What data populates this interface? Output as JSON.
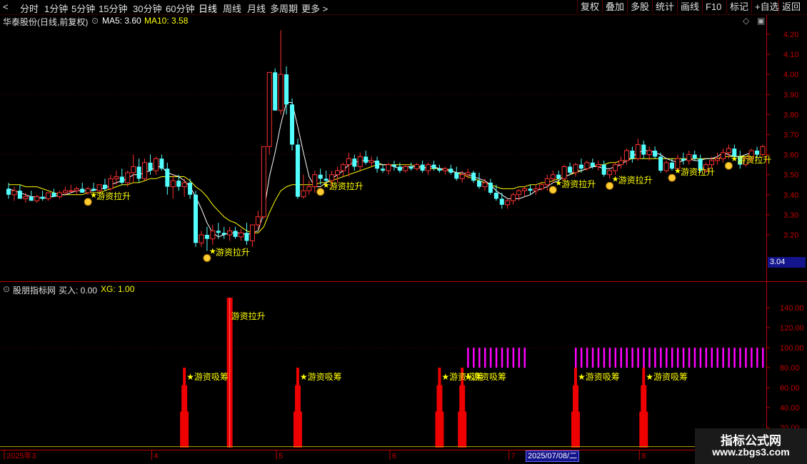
{
  "toolbar": {
    "periods": [
      "分时",
      "1分钟",
      "5分钟",
      "15分钟",
      "30分钟",
      "60分钟",
      "日线",
      "周线",
      "月线",
      "多周期",
      "更多"
    ],
    "active_period": "日线",
    "buttons": [
      "复权",
      "叠加",
      "多股",
      "统计",
      "画线",
      "F10",
      "标记",
      "+自选",
      "返回"
    ]
  },
  "header": {
    "stock": "华泰股份(日线,前复权)",
    "ma5_label": "MA5: 3.60",
    "ma10_label": "MA10: 3.58"
  },
  "indicator_header": {
    "name": "股朋指标网",
    "buy_label": "买入: 0.00",
    "xg_label": "XG: 1.00"
  },
  "price_tag": "3.04",
  "date_tag": "2025/07/08/二",
  "watermark": {
    "line1": "指标公式网",
    "line2": "www.zbgs3.com"
  },
  "colors": {
    "up": "#ff3232",
    "down": "#54ffff",
    "ma5": "#ffffff",
    "ma10": "#ffff00",
    "magenta": "#ff00ff",
    "axis": "#c00000",
    "label": "#ffff00"
  },
  "chart_data": {
    "type": "candlestick",
    "price_axis": {
      "ticks": [
        "3.20",
        "3.30",
        "3.40",
        "3.50",
        "3.60",
        "3.70",
        "3.80",
        "3.90",
        "4.00",
        "4.10",
        "4.20"
      ],
      "ylim": [
        3.04,
        4.25
      ]
    },
    "indicator_axis": {
      "ticks": [
        "20.00",
        "40.00",
        "60.00",
        "80.00",
        "100.00",
        "120.00",
        "140.00"
      ],
      "ylim": [
        0,
        150
      ]
    },
    "x_labels": [
      "2025年3",
      "4",
      "5",
      "6",
      "7",
      "8"
    ],
    "ohlc": [
      [
        3.43,
        3.46,
        3.38,
        3.4
      ],
      [
        3.4,
        3.44,
        3.37,
        3.42
      ],
      [
        3.42,
        3.45,
        3.39,
        3.38
      ],
      [
        3.38,
        3.41,
        3.36,
        3.39
      ],
      [
        3.39,
        3.42,
        3.37,
        3.37
      ],
      [
        3.37,
        3.4,
        3.36,
        3.39
      ],
      [
        3.39,
        3.42,
        3.37,
        3.38
      ],
      [
        3.38,
        3.41,
        3.37,
        3.41
      ],
      [
        3.41,
        3.43,
        3.39,
        3.39
      ],
      [
        3.39,
        3.42,
        3.38,
        3.41
      ],
      [
        3.41,
        3.44,
        3.4,
        3.42
      ],
      [
        3.42,
        3.45,
        3.41,
        3.42
      ],
      [
        3.42,
        3.44,
        3.4,
        3.43
      ],
      [
        3.43,
        3.46,
        3.41,
        3.41
      ],
      [
        3.41,
        3.44,
        3.4,
        3.43
      ],
      [
        3.43,
        3.46,
        3.42,
        3.42
      ],
      [
        3.42,
        3.45,
        3.41,
        3.45
      ],
      [
        3.45,
        3.48,
        3.42,
        3.43
      ],
      [
        3.43,
        3.5,
        3.42,
        3.48
      ],
      [
        3.48,
        3.52,
        3.45,
        3.49
      ],
      [
        3.49,
        3.53,
        3.45,
        3.46
      ],
      [
        3.46,
        3.52,
        3.44,
        3.51
      ],
      [
        3.51,
        3.6,
        3.46,
        3.54
      ],
      [
        3.54,
        3.58,
        3.46,
        3.48
      ],
      [
        3.48,
        3.58,
        3.47,
        3.56
      ],
      [
        3.56,
        3.6,
        3.5,
        3.52
      ],
      [
        3.52,
        3.59,
        3.5,
        3.58
      ],
      [
        3.58,
        3.6,
        3.52,
        3.53
      ],
      [
        3.53,
        3.56,
        3.4,
        3.44
      ],
      [
        3.44,
        3.5,
        3.38,
        3.47
      ],
      [
        3.47,
        3.5,
        3.42,
        3.44
      ],
      [
        3.44,
        3.48,
        3.39,
        3.46
      ],
      [
        3.46,
        3.48,
        3.38,
        3.4
      ],
      [
        3.4,
        3.42,
        3.14,
        3.16
      ],
      [
        3.16,
        3.22,
        3.14,
        3.2
      ],
      [
        3.2,
        3.24,
        3.12,
        3.18
      ],
      [
        3.18,
        3.25,
        3.15,
        3.22
      ],
      [
        3.22,
        3.26,
        3.18,
        3.21
      ],
      [
        3.21,
        3.24,
        3.18,
        3.2
      ],
      [
        3.2,
        3.24,
        3.17,
        3.22
      ],
      [
        3.22,
        3.24,
        3.18,
        3.19
      ],
      [
        3.19,
        3.23,
        3.17,
        3.21
      ],
      [
        3.21,
        3.26,
        3.15,
        3.17
      ],
      [
        3.17,
        3.25,
        3.14,
        3.25
      ],
      [
        3.25,
        3.32,
        3.23,
        3.29
      ],
      [
        3.29,
        3.64,
        3.28,
        3.64
      ],
      [
        3.64,
        4.01,
        3.6,
        4.01
      ],
      [
        4.01,
        4.03,
        3.82,
        3.82
      ],
      [
        3.82,
        4.22,
        3.8,
        4.0
      ],
      [
        4.0,
        4.04,
        3.8,
        3.85
      ],
      [
        3.85,
        3.88,
        3.62,
        3.65
      ],
      [
        3.65,
        3.68,
        3.38,
        3.39
      ],
      [
        3.39,
        3.5,
        3.38,
        3.42
      ],
      [
        3.42,
        3.47,
        3.4,
        3.44
      ],
      [
        3.44,
        3.52,
        3.41,
        3.5
      ],
      [
        3.5,
        3.53,
        3.45,
        3.48
      ],
      [
        3.48,
        3.52,
        3.45,
        3.47
      ],
      [
        3.47,
        3.52,
        3.44,
        3.5
      ],
      [
        3.5,
        3.54,
        3.46,
        3.52
      ],
      [
        3.52,
        3.56,
        3.49,
        3.55
      ],
      [
        3.55,
        3.61,
        3.49,
        3.58
      ],
      [
        3.58,
        3.6,
        3.52,
        3.54
      ],
      [
        3.54,
        3.61,
        3.52,
        3.59
      ],
      [
        3.59,
        3.62,
        3.55,
        3.56
      ],
      [
        3.56,
        3.59,
        3.54,
        3.57
      ],
      [
        3.57,
        3.59,
        3.51,
        3.53
      ],
      [
        3.53,
        3.55,
        3.51,
        3.52
      ],
      [
        3.52,
        3.56,
        3.5,
        3.55
      ],
      [
        3.55,
        3.57,
        3.52,
        3.54
      ],
      [
        3.54,
        3.56,
        3.51,
        3.52
      ],
      [
        3.52,
        3.55,
        3.51,
        3.54
      ],
      [
        3.54,
        3.56,
        3.52,
        3.53
      ],
      [
        3.53,
        3.56,
        3.52,
        3.55
      ],
      [
        3.55,
        3.57,
        3.51,
        3.52
      ],
      [
        3.52,
        3.56,
        3.5,
        3.55
      ],
      [
        3.55,
        3.57,
        3.52,
        3.53
      ],
      [
        3.53,
        3.55,
        3.51,
        3.52
      ],
      [
        3.52,
        3.54,
        3.5,
        3.53
      ],
      [
        3.53,
        3.55,
        3.5,
        3.51
      ],
      [
        3.51,
        3.54,
        3.47,
        3.48
      ],
      [
        3.48,
        3.52,
        3.46,
        3.5
      ],
      [
        3.5,
        3.53,
        3.48,
        3.51
      ],
      [
        3.51,
        3.52,
        3.46,
        3.47
      ],
      [
        3.47,
        3.51,
        3.43,
        3.44
      ],
      [
        3.44,
        3.48,
        3.42,
        3.46
      ],
      [
        3.46,
        3.48,
        3.4,
        3.41
      ],
      [
        3.41,
        3.45,
        3.37,
        3.38
      ],
      [
        3.38,
        3.41,
        3.33,
        3.35
      ],
      [
        3.35,
        3.38,
        3.33,
        3.37
      ],
      [
        3.37,
        3.41,
        3.35,
        3.4
      ],
      [
        3.4,
        3.43,
        3.37,
        3.42
      ],
      [
        3.42,
        3.44,
        3.39,
        3.43
      ],
      [
        3.43,
        3.45,
        3.4,
        3.42
      ],
      [
        3.42,
        3.45,
        3.4,
        3.43
      ],
      [
        3.43,
        3.46,
        3.42,
        3.45
      ],
      [
        3.45,
        3.5,
        3.42,
        3.48
      ],
      [
        3.48,
        3.52,
        3.46,
        3.5
      ],
      [
        3.5,
        3.52,
        3.47,
        3.48
      ],
      [
        3.48,
        3.55,
        3.47,
        3.54
      ],
      [
        3.54,
        3.56,
        3.5,
        3.51
      ],
      [
        3.51,
        3.56,
        3.49,
        3.55
      ],
      [
        3.55,
        3.58,
        3.51,
        3.53
      ],
      [
        3.53,
        3.57,
        3.52,
        3.56
      ],
      [
        3.56,
        3.58,
        3.53,
        3.54
      ],
      [
        3.54,
        3.57,
        3.52,
        3.55
      ],
      [
        3.55,
        3.57,
        3.49,
        3.5
      ],
      [
        3.5,
        3.53,
        3.48,
        3.52
      ],
      [
        3.52,
        3.56,
        3.5,
        3.55
      ],
      [
        3.55,
        3.59,
        3.53,
        3.57
      ],
      [
        3.57,
        3.63,
        3.55,
        3.62
      ],
      [
        3.62,
        3.64,
        3.56,
        3.58
      ],
      [
        3.58,
        3.68,
        3.57,
        3.65
      ],
      [
        3.65,
        3.67,
        3.58,
        3.6
      ],
      [
        3.6,
        3.64,
        3.57,
        3.62
      ],
      [
        3.62,
        3.64,
        3.58,
        3.59
      ],
      [
        3.59,
        3.61,
        3.51,
        3.52
      ],
      [
        3.52,
        3.57,
        3.51,
        3.56
      ],
      [
        3.56,
        3.58,
        3.52,
        3.53
      ],
      [
        3.53,
        3.6,
        3.52,
        3.58
      ],
      [
        3.58,
        3.61,
        3.55,
        3.57
      ],
      [
        3.57,
        3.62,
        3.55,
        3.6
      ],
      [
        3.6,
        3.62,
        3.57,
        3.58
      ],
      [
        3.58,
        3.6,
        3.51,
        3.52
      ],
      [
        3.52,
        3.56,
        3.51,
        3.55
      ],
      [
        3.55,
        3.59,
        3.53,
        3.57
      ],
      [
        3.57,
        3.61,
        3.55,
        3.58
      ],
      [
        3.58,
        3.63,
        3.56,
        3.61
      ],
      [
        3.61,
        3.65,
        3.58,
        3.63
      ],
      [
        3.63,
        3.65,
        3.58,
        3.59
      ],
      [
        3.59,
        3.62,
        3.53,
        3.55
      ],
      [
        3.55,
        3.59,
        3.54,
        3.58
      ],
      [
        3.58,
        3.63,
        3.56,
        3.62
      ],
      [
        3.62,
        3.64,
        3.58,
        3.6
      ],
      [
        3.6,
        3.65,
        3.59,
        3.64
      ]
    ],
    "ma5": [
      3.43,
      3.42,
      3.41,
      3.4,
      3.39,
      3.39,
      3.38,
      3.39,
      3.39,
      3.4,
      3.4,
      3.41,
      3.42,
      3.42,
      3.42,
      3.42,
      3.43,
      3.43,
      3.45,
      3.46,
      3.47,
      3.48,
      3.5,
      3.5,
      3.51,
      3.52,
      3.54,
      3.54,
      3.51,
      3.5,
      3.49,
      3.47,
      3.44,
      3.39,
      3.33,
      3.26,
      3.21,
      3.19,
      3.2,
      3.21,
      3.21,
      3.21,
      3.2,
      3.21,
      3.22,
      3.31,
      3.49,
      3.61,
      3.75,
      3.86,
      3.86,
      3.74,
      3.61,
      3.49,
      3.44,
      3.44,
      3.46,
      3.48,
      3.5,
      3.52,
      3.55,
      3.56,
      3.57,
      3.57,
      3.57,
      3.56,
      3.55,
      3.55,
      3.54,
      3.53,
      3.54,
      3.54,
      3.54,
      3.53,
      3.54,
      3.54,
      3.53,
      3.53,
      3.52,
      3.51,
      3.51,
      3.5,
      3.49,
      3.48,
      3.47,
      3.45,
      3.42,
      3.4,
      3.38,
      3.38,
      3.38,
      3.39,
      3.4,
      3.42,
      3.43,
      3.44,
      3.46,
      3.47,
      3.49,
      3.5,
      3.52,
      3.52,
      3.53,
      3.54,
      3.54,
      3.53,
      3.53,
      3.54,
      3.55,
      3.57,
      3.59,
      3.61,
      3.62,
      3.62,
      3.61,
      3.6,
      3.58,
      3.57,
      3.56,
      3.57,
      3.58,
      3.57,
      3.57,
      3.58,
      3.58,
      3.59,
      3.61,
      3.6,
      3.59,
      3.59,
      3.6,
      3.61
    ],
    "ma10": [
      3.45,
      3.45,
      3.45,
      3.44,
      3.44,
      3.44,
      3.43,
      3.42,
      3.41,
      3.4,
      3.4,
      3.4,
      3.4,
      3.4,
      3.41,
      3.41,
      3.41,
      3.42,
      3.43,
      3.44,
      3.45,
      3.45,
      3.46,
      3.46,
      3.47,
      3.48,
      3.48,
      3.49,
      3.49,
      3.49,
      3.49,
      3.49,
      3.47,
      3.44,
      3.42,
      3.39,
      3.35,
      3.32,
      3.29,
      3.27,
      3.26,
      3.24,
      3.22,
      3.21,
      3.21,
      3.24,
      3.31,
      3.37,
      3.42,
      3.44,
      3.45,
      3.45,
      3.45,
      3.45,
      3.45,
      3.46,
      3.46,
      3.47,
      3.48,
      3.49,
      3.5,
      3.51,
      3.52,
      3.53,
      3.54,
      3.55,
      3.55,
      3.55,
      3.55,
      3.55,
      3.55,
      3.55,
      3.54,
      3.54,
      3.53,
      3.53,
      3.53,
      3.52,
      3.52,
      3.51,
      3.5,
      3.49,
      3.48,
      3.47,
      3.46,
      3.45,
      3.44,
      3.43,
      3.43,
      3.43,
      3.44,
      3.44,
      3.45,
      3.45,
      3.46,
      3.46,
      3.47,
      3.48,
      3.49,
      3.5,
      3.51,
      3.52,
      3.53,
      3.54,
      3.55,
      3.55,
      3.56,
      3.56,
      3.57,
      3.57,
      3.58,
      3.58,
      3.58,
      3.58,
      3.58,
      3.58,
      3.58,
      3.58,
      3.58,
      3.58,
      3.58,
      3.58,
      3.58,
      3.58,
      3.58,
      3.58,
      3.59,
      3.59,
      3.59,
      3.59,
      3.59,
      3.6
    ],
    "signals_price": [
      {
        "i": 14,
        "label": "游资拉升"
      },
      {
        "i": 35,
        "label": "游资拉升"
      },
      {
        "i": 55,
        "label": "游资拉升"
      },
      {
        "i": 96,
        "label": "游资拉升"
      },
      {
        "i": 106,
        "label": "游资拉升"
      },
      {
        "i": 117,
        "label": "游资拉升"
      },
      {
        "i": 127,
        "label": "游资拉升"
      }
    ],
    "indicator_bars": [
      {
        "i": 31,
        "value": 80
      },
      {
        "i": 39,
        "value": 150
      },
      {
        "i": 51,
        "value": 80
      },
      {
        "i": 76,
        "value": 80
      },
      {
        "i": 80,
        "value": 80
      },
      {
        "i": 100,
        "value": 80
      },
      {
        "i": 112,
        "value": 80
      }
    ],
    "indicator_labels": [
      {
        "i": 31,
        "label": "★游资吸筹"
      },
      {
        "i": 39,
        "label": "游资拉升"
      },
      {
        "i": 51,
        "label": "★游资吸筹"
      },
      {
        "i": 76,
        "label": "★游资吸筹"
      },
      {
        "i": 80,
        "label": "★游资吸筹"
      },
      {
        "i": 100,
        "label": "★游资吸筹"
      },
      {
        "i": 112,
        "label": "★游资吸筹"
      }
    ],
    "magenta_ranges": [
      {
        "from": 81,
        "to": 91,
        "low": 80,
        "high": 100
      },
      {
        "from": 100,
        "to": 133,
        "low": 80,
        "high": 100
      }
    ]
  }
}
